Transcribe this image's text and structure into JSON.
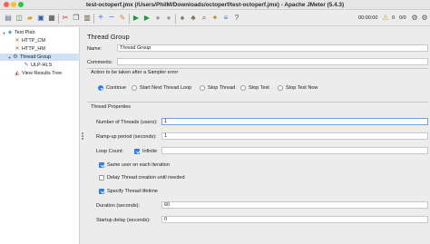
{
  "window": {
    "title": "test-octoperf.jmx (/Users/PhilM/Downloads/octoperf/test-octoperf.jmx) - Apache JMeter (5.4.3)"
  },
  "toolbar": {
    "timer": "00:00:00",
    "warning_count": "0",
    "threads_ratio": "0/0"
  },
  "tree": {
    "items": [
      {
        "label": "Test Plan",
        "icon": "test-plan-icon"
      },
      {
        "label": "HTTP_CM",
        "icon": "config-element-icon"
      },
      {
        "label": "HTTP_HM",
        "icon": "config-element-icon"
      },
      {
        "label": "Thread Group",
        "icon": "thread-group-icon"
      },
      {
        "label": "ULP-HLS",
        "icon": "sampler-icon"
      },
      {
        "label": "View Results Tree",
        "icon": "listener-icon"
      }
    ]
  },
  "panel": {
    "heading": "Thread Group",
    "name_label": "Name:",
    "name_value": "Thread Group",
    "comments_label": "Comments:",
    "comments_value": "",
    "action_label": "Action to be taken after a Sampler error",
    "actions": [
      {
        "label": "Continue",
        "selected": true
      },
      {
        "label": "Start Next Thread Loop",
        "selected": false
      },
      {
        "label": "Stop Thread",
        "selected": false
      },
      {
        "label": "Stop Test",
        "selected": false
      },
      {
        "label": "Stop Test Now",
        "selected": false
      }
    ],
    "props_label": "Thread Properties",
    "threads_label": "Number of Threads (users):",
    "threads_value": "1",
    "rampup_label": "Ramp-up period (seconds):",
    "rampup_value": "1",
    "loop_label": "Loop Count:",
    "infinite_label": "Infinite",
    "infinite_checked": true,
    "loop_value": "",
    "same_user_label": "Same user on each iteration",
    "same_user_checked": true,
    "delay_label": "Delay Thread creation until needed",
    "delay_checked": false,
    "lifetime_label": "Specify Thread lifetime",
    "lifetime_checked": true,
    "duration_label": "Duration (seconds):",
    "duration_value": "60",
    "startup_label": "Startup delay (seconds):",
    "startup_value": "0"
  },
  "colors": {
    "accent": "#2f7ef6",
    "selection": "#cfe0f4",
    "focus_border": "#6fa3e0"
  }
}
